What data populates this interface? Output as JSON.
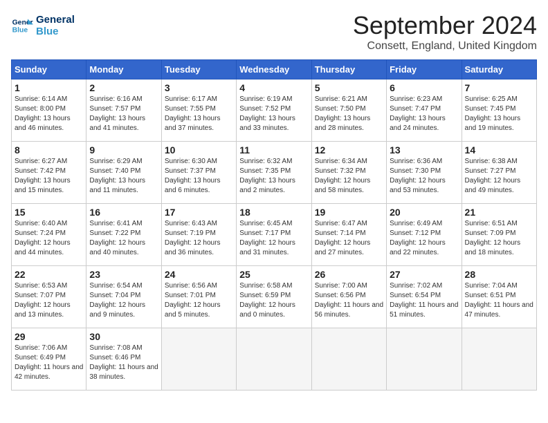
{
  "header": {
    "logo_line1": "General",
    "logo_line2": "Blue",
    "month_title": "September 2024",
    "location": "Consett, England, United Kingdom"
  },
  "columns": [
    "Sunday",
    "Monday",
    "Tuesday",
    "Wednesday",
    "Thursday",
    "Friday",
    "Saturday"
  ],
  "weeks": [
    [
      {
        "day": "1",
        "sunrise": "6:14 AM",
        "sunset": "8:00 PM",
        "daylight": "13 hours and 46 minutes."
      },
      {
        "day": "2",
        "sunrise": "6:16 AM",
        "sunset": "7:57 PM",
        "daylight": "13 hours and 41 minutes."
      },
      {
        "day": "3",
        "sunrise": "6:17 AM",
        "sunset": "7:55 PM",
        "daylight": "13 hours and 37 minutes."
      },
      {
        "day": "4",
        "sunrise": "6:19 AM",
        "sunset": "7:52 PM",
        "daylight": "13 hours and 33 minutes."
      },
      {
        "day": "5",
        "sunrise": "6:21 AM",
        "sunset": "7:50 PM",
        "daylight": "13 hours and 28 minutes."
      },
      {
        "day": "6",
        "sunrise": "6:23 AM",
        "sunset": "7:47 PM",
        "daylight": "13 hours and 24 minutes."
      },
      {
        "day": "7",
        "sunrise": "6:25 AM",
        "sunset": "7:45 PM",
        "daylight": "13 hours and 19 minutes."
      }
    ],
    [
      {
        "day": "8",
        "sunrise": "6:27 AM",
        "sunset": "7:42 PM",
        "daylight": "13 hours and 15 minutes."
      },
      {
        "day": "9",
        "sunrise": "6:29 AM",
        "sunset": "7:40 PM",
        "daylight": "13 hours and 11 minutes."
      },
      {
        "day": "10",
        "sunrise": "6:30 AM",
        "sunset": "7:37 PM",
        "daylight": "13 hours and 6 minutes."
      },
      {
        "day": "11",
        "sunrise": "6:32 AM",
        "sunset": "7:35 PM",
        "daylight": "13 hours and 2 minutes."
      },
      {
        "day": "12",
        "sunrise": "6:34 AM",
        "sunset": "7:32 PM",
        "daylight": "12 hours and 58 minutes."
      },
      {
        "day": "13",
        "sunrise": "6:36 AM",
        "sunset": "7:30 PM",
        "daylight": "12 hours and 53 minutes."
      },
      {
        "day": "14",
        "sunrise": "6:38 AM",
        "sunset": "7:27 PM",
        "daylight": "12 hours and 49 minutes."
      }
    ],
    [
      {
        "day": "15",
        "sunrise": "6:40 AM",
        "sunset": "7:24 PM",
        "daylight": "12 hours and 44 minutes."
      },
      {
        "day": "16",
        "sunrise": "6:41 AM",
        "sunset": "7:22 PM",
        "daylight": "12 hours and 40 minutes."
      },
      {
        "day": "17",
        "sunrise": "6:43 AM",
        "sunset": "7:19 PM",
        "daylight": "12 hours and 36 minutes."
      },
      {
        "day": "18",
        "sunrise": "6:45 AM",
        "sunset": "7:17 PM",
        "daylight": "12 hours and 31 minutes."
      },
      {
        "day": "19",
        "sunrise": "6:47 AM",
        "sunset": "7:14 PM",
        "daylight": "12 hours and 27 minutes."
      },
      {
        "day": "20",
        "sunrise": "6:49 AM",
        "sunset": "7:12 PM",
        "daylight": "12 hours and 22 minutes."
      },
      {
        "day": "21",
        "sunrise": "6:51 AM",
        "sunset": "7:09 PM",
        "daylight": "12 hours and 18 minutes."
      }
    ],
    [
      {
        "day": "22",
        "sunrise": "6:53 AM",
        "sunset": "7:07 PM",
        "daylight": "12 hours and 13 minutes."
      },
      {
        "day": "23",
        "sunrise": "6:54 AM",
        "sunset": "7:04 PM",
        "daylight": "12 hours and 9 minutes."
      },
      {
        "day": "24",
        "sunrise": "6:56 AM",
        "sunset": "7:01 PM",
        "daylight": "12 hours and 5 minutes."
      },
      {
        "day": "25",
        "sunrise": "6:58 AM",
        "sunset": "6:59 PM",
        "daylight": "12 hours and 0 minutes."
      },
      {
        "day": "26",
        "sunrise": "7:00 AM",
        "sunset": "6:56 PM",
        "daylight": "11 hours and 56 minutes."
      },
      {
        "day": "27",
        "sunrise": "7:02 AM",
        "sunset": "6:54 PM",
        "daylight": "11 hours and 51 minutes."
      },
      {
        "day": "28",
        "sunrise": "7:04 AM",
        "sunset": "6:51 PM",
        "daylight": "11 hours and 47 minutes."
      }
    ],
    [
      {
        "day": "29",
        "sunrise": "7:06 AM",
        "sunset": "6:49 PM",
        "daylight": "11 hours and 42 minutes."
      },
      {
        "day": "30",
        "sunrise": "7:08 AM",
        "sunset": "6:46 PM",
        "daylight": "11 hours and 38 minutes."
      },
      null,
      null,
      null,
      null,
      null
    ]
  ]
}
